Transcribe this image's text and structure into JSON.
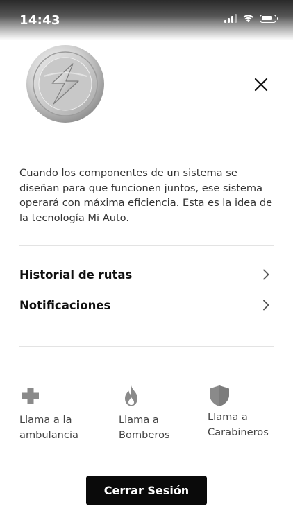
{
  "status_bar": {
    "time": "14:43",
    "icons": [
      "signal-icon",
      "wifi-icon",
      "battery-icon"
    ],
    "battery_level": 0.85
  },
  "header": {
    "logo_icon": "lightning-bolt-logo",
    "close_icon": "close-icon"
  },
  "description": "Cuando los componentes de un sistema se diseñan para que funcionen juntos, ese sistema operará con máxima eficiencia. Esta es la idea de la tecnología Mi Auto.",
  "menu": {
    "items": [
      {
        "label": "Historial de rutas",
        "icon": "chevron-right-icon"
      },
      {
        "label": "Notificaciones",
        "icon": "chevron-right-icon"
      }
    ]
  },
  "emergency": {
    "items": [
      {
        "label": "Llama a la\nambulancia",
        "icon": "plus-cross-icon"
      },
      {
        "label": "Llama a\nBomberos",
        "icon": "flame-icon"
      },
      {
        "label": "Llama a\nCarabineros",
        "icon": "shield-icon"
      }
    ]
  },
  "logout": {
    "label": "Cerrar Sesión"
  },
  "colors": {
    "accent": "#0a0a0a",
    "icon_gray": "#8a8a8a",
    "divider": "#e3e3e3"
  }
}
